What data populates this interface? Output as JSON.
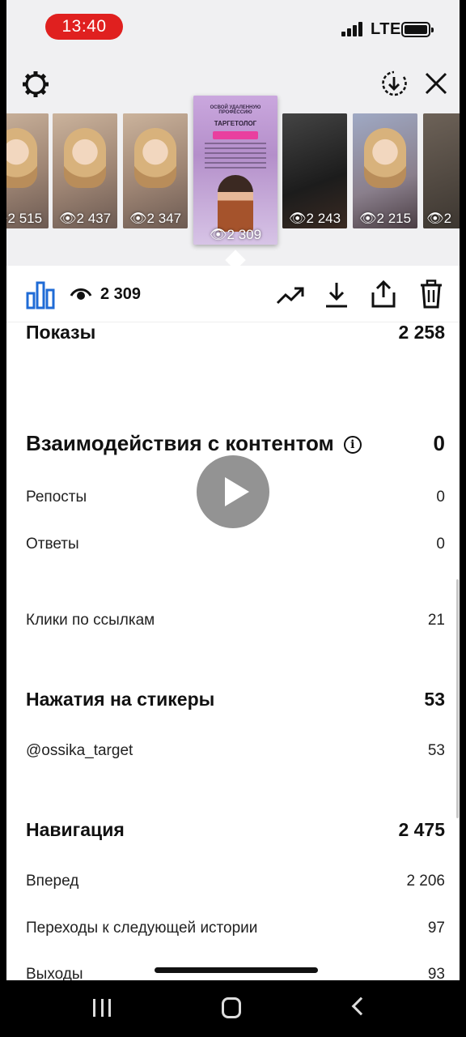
{
  "status_bar": {
    "time": "13:40",
    "network": "LTE"
  },
  "header": {
    "thumbnails": [
      {
        "views": "2 515"
      },
      {
        "views": "2 437"
      },
      {
        "views": "2 347"
      },
      {
        "views": "2 309",
        "active": true,
        "title_text": "ОСВОЙ УДАЛЕННУЮ ПРОФЕССИЮ",
        "subtitle_text": "ТАРГЕТОЛОГ"
      },
      {
        "views": "2 243"
      },
      {
        "views": "2 215"
      },
      {
        "views": "2"
      }
    ]
  },
  "toolbar": {
    "views": "2 309"
  },
  "stats": {
    "impressions": {
      "label": "Показы",
      "value": "2 258"
    },
    "interactions": {
      "label": "Взаимодействия с контентом",
      "value": "0"
    },
    "reposts": {
      "label": "Репосты",
      "value": "0"
    },
    "replies": {
      "label": "Ответы",
      "value": "0"
    },
    "link_clicks": {
      "label": "Клики по ссылкам",
      "value": "21"
    },
    "sticker_taps": {
      "label": "Нажатия на стикеры",
      "value": "53"
    },
    "sticker_account": {
      "label": "@ossika_target",
      "value": "53"
    },
    "navigation": {
      "label": "Навигация",
      "value": "2 475"
    },
    "forward": {
      "label": "Вперед",
      "value": "2 206"
    },
    "next_story": {
      "label": "Переходы к следующей истории",
      "value": "97"
    },
    "exits": {
      "label": "Выходы",
      "value": "93"
    }
  },
  "colors": {
    "accent": "#1f6bd6",
    "time_pill": "#e0201f"
  }
}
